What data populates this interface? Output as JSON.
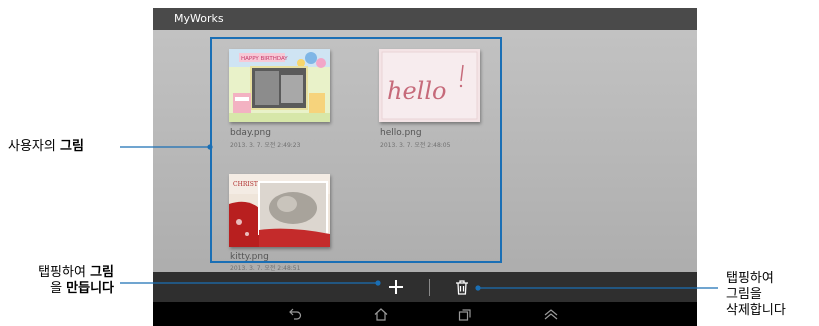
{
  "app": {
    "title": "MyWorks"
  },
  "gallery": {
    "items": [
      {
        "name": "bday.png",
        "date": "2013. 3. 7. 오전 2:49:23"
      },
      {
        "name": "hello.png",
        "date": "2013. 3. 7. 오전 2:48:05"
      },
      {
        "name": "kitty.png",
        "date": "2013. 3. 7. 오전 2:48:51"
      }
    ],
    "thumb_text": {
      "bday": "HAPPY BIRTHDAY",
      "hello": "hello",
      "kitty": "CHRISTMAS"
    }
  },
  "annotations": {
    "drawings_pre": "사용자의 ",
    "drawings_bold": "그림",
    "create_line1_pre": "탭핑하여 ",
    "create_line1_bold": "그림",
    "create_line2_pre": "을 ",
    "create_line2_bold": "만듭니다",
    "delete_line1": "탭핑하여",
    "delete_line2": "그림을",
    "delete_line3": "삭제합니다"
  },
  "colors": {
    "callout_line": "#1a6fb5",
    "titlebar": "#4a4a4a",
    "toolbar": "#2f2f2f",
    "navbar": "#000000"
  },
  "icons": {
    "toolbar": [
      "plus-icon",
      "trash-icon"
    ],
    "navbar": [
      "back-icon",
      "home-icon",
      "recent-apps-icon",
      "menu-up-icon"
    ]
  }
}
